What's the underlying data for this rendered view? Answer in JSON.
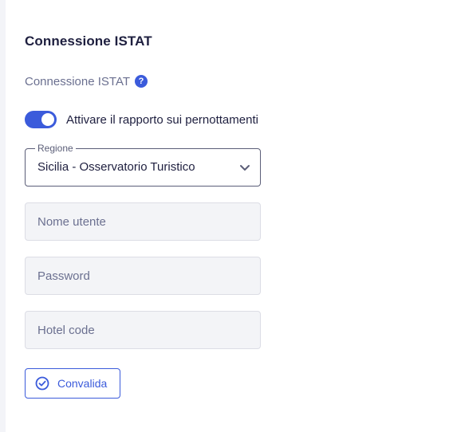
{
  "section": {
    "title": "Connessione ISTAT",
    "subtitle": "Connessione ISTAT",
    "help_icon": "question-circle-icon",
    "help_glyph": "?"
  },
  "toggle": {
    "label": "Attivare il rapporto sui pernottamenti",
    "state": "on"
  },
  "region": {
    "legend": "Regione",
    "value": "Sicilia - Osservatorio Turistico"
  },
  "fields": {
    "username_placeholder": "Nome utente",
    "password_placeholder": "Password",
    "hotel_code_placeholder": "Hotel code"
  },
  "validate_button": {
    "label": "Convalida",
    "icon": "check-circle-icon"
  },
  "colors": {
    "accent": "#3b5bdb",
    "title_text": "#1e1f3f",
    "muted_text": "#6b7090",
    "input_background": "#f3f4f7"
  }
}
